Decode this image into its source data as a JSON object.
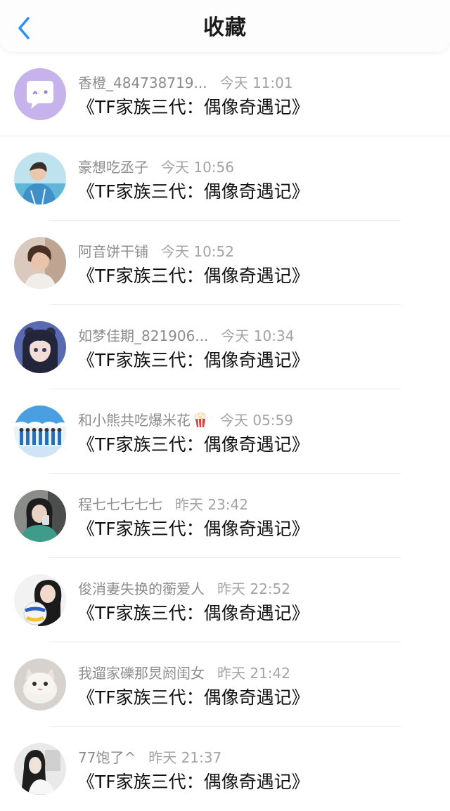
{
  "header": {
    "title": "收藏",
    "back_icon": "chevron-left-icon",
    "accent": "#2f8ef5"
  },
  "items": [
    {
      "name": "香橙_484738719...",
      "time": "今天 11:01",
      "title": "《TF家族三代：偶像奇遇记》",
      "avatar": "default-chat-avatar"
    },
    {
      "name": "豪想吃丞子",
      "time": "今天 10:56",
      "title": "《TF家族三代：偶像奇遇记》",
      "avatar": "photo-avatar"
    },
    {
      "name": "阿音饼干铺",
      "time": "今天 10:52",
      "title": "《TF家族三代：偶像奇遇记》",
      "avatar": "photo-avatar"
    },
    {
      "name": "如梦佳期_821906...",
      "time": "今天 10:34",
      "title": "《TF家族三代：偶像奇遇记》",
      "avatar": "photo-avatar"
    },
    {
      "name": "和小熊共吃爆米花",
      "time": "今天 05:59",
      "title": "《TF家族三代：偶像奇遇记》",
      "avatar": "photo-avatar",
      "name_icon": "popcorn-icon"
    },
    {
      "name": "程七七七七七",
      "time": "昨天 23:42",
      "title": "《TF家族三代：偶像奇遇记》",
      "avatar": "photo-avatar"
    },
    {
      "name": "俊消妻失换的蘅爱人",
      "time": "昨天 22:52",
      "title": "《TF家族三代：偶像奇遇记》",
      "avatar": "photo-avatar"
    },
    {
      "name": "我遛家礫那炅阏闺女",
      "time": "昨天 21:42",
      "title": "《TF家族三代：偶像奇遇记》",
      "avatar": "photo-avatar"
    },
    {
      "name": "77饱了^",
      "time": "昨天 21:37",
      "title": "《TF家族三代：偶像奇遇记》",
      "avatar": "photo-avatar"
    }
  ]
}
